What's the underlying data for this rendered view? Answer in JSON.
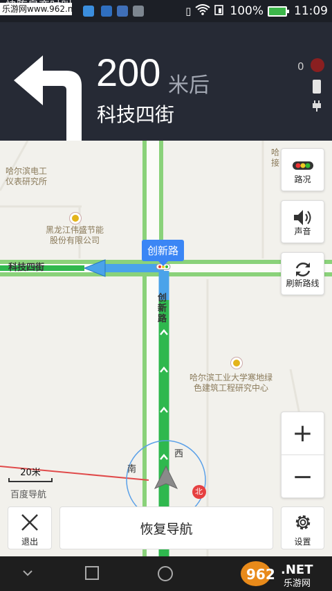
{
  "status_bar": {
    "watermark": "乐游网www.962.net",
    "notification_text": "快陈泉恋吋叫",
    "battery_percent": "100%",
    "time": "11:09"
  },
  "guidance": {
    "distance": "200",
    "distance_unit": "米后",
    "next_road": "科技四街",
    "satellite_count": "0",
    "turn_direction": "left"
  },
  "map": {
    "pois": [
      {
        "name_line1": "哈尔滨电工",
        "name_line2": "仪表研究所"
      },
      {
        "name_line1": "黑龙江伟盛节能",
        "name_line2": "股份有限公司"
      },
      {
        "name_line1": "哈尔滨工业大学寒地绿",
        "name_line2": "色建筑工程研究中心"
      },
      {
        "name_line1": "哈",
        "name_line2": "接"
      }
    ],
    "road_labels": {
      "horizontal": "科技四街",
      "vertical": "创新路",
      "tooltip": "创新路"
    },
    "compass": {
      "west": "西",
      "south": "南",
      "north": "北"
    },
    "scale": "20米",
    "brand": "百度导航"
  },
  "side_buttons": {
    "traffic": "路况",
    "sound": "声音",
    "refresh_route": "刷新路线"
  },
  "bottom": {
    "exit": "退出",
    "resume": "恢复导航",
    "settings": "设置"
  },
  "footer_logo": {
    "number": "962",
    "domain": ".NET",
    "name": "乐游网"
  },
  "colors": {
    "route_green": "#2fb84e",
    "route_blue": "#4aa3ea",
    "panel_bg": "#262a35",
    "tooltip_blue": "#3b86f5"
  }
}
